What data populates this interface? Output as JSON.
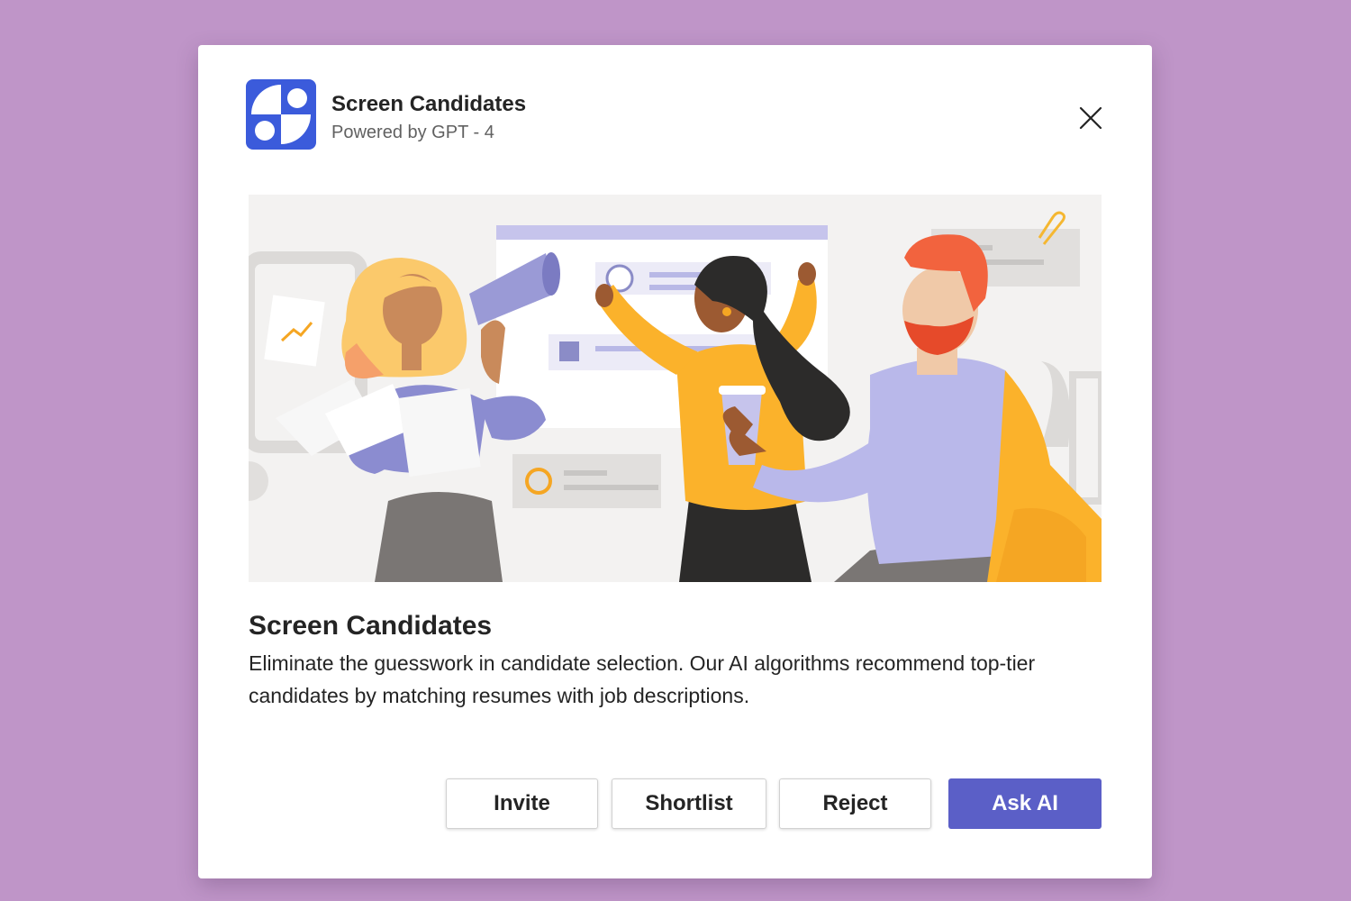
{
  "app": {
    "name": "Screen Candidates",
    "subtitle": "Powered by GPT - 4",
    "icon": "quadrant-logo-icon",
    "brand_color": "#3b5bdb"
  },
  "close": {
    "icon": "close-icon"
  },
  "hero": {
    "illustration": "team-collaboration-illustration"
  },
  "card": {
    "title": "Screen Candidates",
    "description": "Eliminate the guesswork in candidate selection. Our AI algorithms recommend top-tier candidates by matching resumes with job descriptions."
  },
  "actions": {
    "invite_label": "Invite",
    "shortlist_label": "Shortlist",
    "reject_label": "Reject",
    "ask_ai_label": "Ask AI",
    "primary_color": "#5b5fc7"
  },
  "colors": {
    "background": "#bf95c8",
    "dialog": "#ffffff",
    "text": "#242424",
    "muted_text": "#616161"
  }
}
